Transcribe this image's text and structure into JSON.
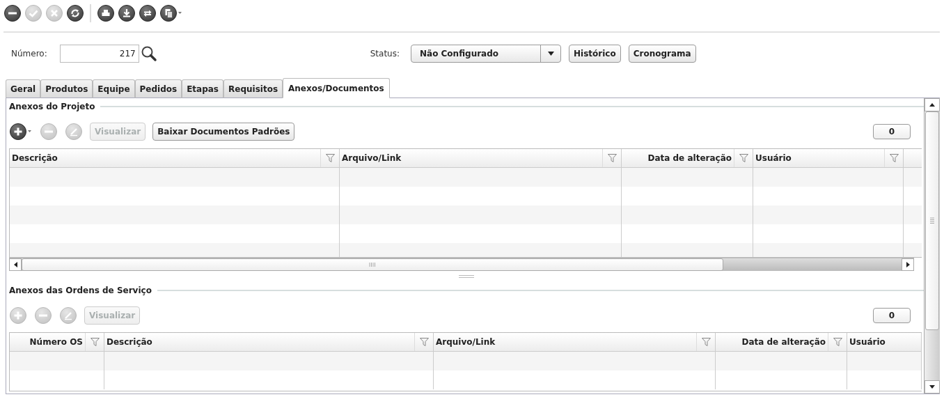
{
  "toolbar": [
    {
      "kind": "minus",
      "disabled": false
    },
    {
      "kind": "check",
      "disabled": true
    },
    {
      "kind": "cancel",
      "disabled": true
    },
    {
      "kind": "refresh",
      "disabled": false
    },
    {
      "kind": "separator"
    },
    {
      "kind": "print",
      "disabled": false
    },
    {
      "kind": "download",
      "disabled": false
    },
    {
      "kind": "sync",
      "disabled": false
    },
    {
      "kind": "document",
      "disabled": false,
      "dropdown": true
    }
  ],
  "form": {
    "number": {
      "label": "Número:",
      "value": "217"
    },
    "status": {
      "label": "Status:",
      "value": "Não Configurado"
    },
    "buttons": [
      "Histórico",
      "Cronograma"
    ]
  },
  "tabs": [
    {
      "label": "Geral",
      "selected": false
    },
    {
      "label": "Produtos",
      "selected": false
    },
    {
      "label": "Equipe",
      "selected": false
    },
    {
      "label": "Pedidos",
      "selected": false
    },
    {
      "label": "Etapas",
      "selected": false
    },
    {
      "label": "Requisitos",
      "selected": false
    },
    {
      "label": "Anexos/Documentos",
      "selected": true
    }
  ],
  "sections": [
    {
      "title": "Anexos do Projeto",
      "count": "0",
      "actions": [
        {
          "kind": "add",
          "disabled": false,
          "dropdown": true
        },
        {
          "kind": "remove",
          "disabled": true
        },
        {
          "kind": "edit",
          "disabled": true
        },
        {
          "kind": "button",
          "label": "Visualizar",
          "disabled": true
        },
        {
          "kind": "button",
          "label": "Baixar Documentos Padrões",
          "disabled": false
        }
      ],
      "columns": [
        {
          "label": "Descrição",
          "filter": true,
          "kind": "text"
        },
        {
          "label": "Arquivo/Link",
          "filter": true,
          "kind": "text"
        },
        {
          "label": "Data de alteração",
          "filter": true,
          "kind": "date"
        },
        {
          "label": "Usuário",
          "filter": true,
          "kind": "text"
        }
      ]
    },
    {
      "title": "Anexos das Ordens de Serviço",
      "count": "0",
      "actions": [
        {
          "kind": "add",
          "disabled": true
        },
        {
          "kind": "remove",
          "disabled": true
        },
        {
          "kind": "edit",
          "disabled": true
        },
        {
          "kind": "button",
          "label": "Visualizar",
          "disabled": true
        }
      ],
      "columns": [
        {
          "label": "Número OS",
          "filter": true,
          "kind": "number"
        },
        {
          "label": "Descrição",
          "filter": true,
          "kind": "text"
        },
        {
          "label": "Arquivo/Link",
          "filter": true,
          "kind": "text"
        },
        {
          "label": "Data de alteração",
          "filter": true,
          "kind": "date"
        },
        {
          "label": "Usuário",
          "filter": false,
          "kind": "text"
        }
      ]
    }
  ]
}
